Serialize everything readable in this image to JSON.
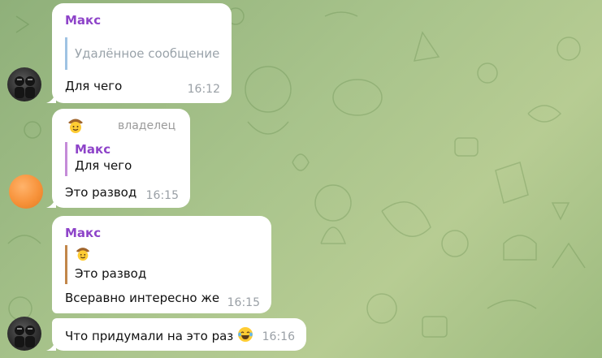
{
  "colors": {
    "sender": "#8e44c9",
    "quote_deleted": "#9fc3e3",
    "quote_purple": "#c58bd8",
    "quote_brown": "#c2874a",
    "time": "#9aa0a6",
    "background": "#a9c48c"
  },
  "messages": [
    {
      "sender": "Макс",
      "reply": {
        "text": "Удалённое сообщение"
      },
      "text": "Для чего",
      "time": "16:12",
      "avatar": "dark-avatar"
    },
    {
      "role": "владелец",
      "sender_icon": "cowboy-emoji",
      "reply": {
        "sender": "Макс",
        "text": "Для чего"
      },
      "text": "Это развод",
      "time": "16:15",
      "avatar": "orange-avatar"
    },
    {
      "sender": "Макс",
      "reply": {
        "icon": "cowboy-emoji",
        "text": "Это развод"
      },
      "text": "Всеравно интересно же",
      "time": "16:15"
    },
    {
      "text": "Что придумали на это раз",
      "emoji": "laughing-emoji",
      "time": "16:16",
      "avatar": "dark-avatar"
    }
  ]
}
